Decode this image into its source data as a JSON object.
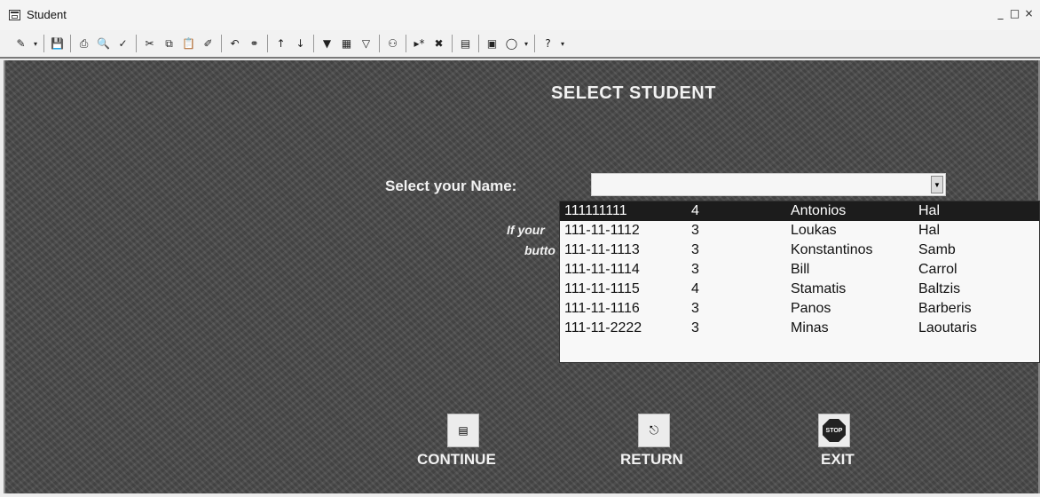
{
  "window": {
    "title": "Student",
    "controls": [
      "_",
      "□",
      "×"
    ]
  },
  "toolbar": {
    "icons": [
      "view-icon",
      "save-icon",
      "print-icon",
      "print-preview-icon",
      "spelling-icon",
      "cut-icon",
      "copy-icon",
      "paste-icon",
      "format-painter-icon",
      "undo-icon",
      "hyperlink-icon",
      "sort-ascending-icon",
      "sort-descending-icon",
      "filter-by-selection-icon",
      "filter-by-form-icon",
      "apply-filter-icon",
      "find-icon",
      "new-record-icon",
      "delete-record-icon",
      "properties-icon",
      "database-window-icon",
      "new-object-icon",
      "help-icon"
    ]
  },
  "form": {
    "title": "SELECT STUDENT",
    "select_label": "Select your Name:",
    "combo_value": "",
    "hint_line1": "If your",
    "hint_line2": "butto"
  },
  "dropdown": {
    "selected_index": 0,
    "rows": [
      {
        "id": "111111111",
        "num": "4",
        "first": "Antonios",
        "last": "Hal"
      },
      {
        "id": "111-11-1112",
        "num": "3",
        "first": "Loukas",
        "last": "Hal"
      },
      {
        "id": "111-11-1113",
        "num": "3",
        "first": "Konstantinos",
        "last": "Samb"
      },
      {
        "id": "111-11-1114",
        "num": "3",
        "first": "Bill",
        "last": "Carrol"
      },
      {
        "id": "111-11-1115",
        "num": "4",
        "first": "Stamatis",
        "last": "Baltzis"
      },
      {
        "id": "111-11-1116",
        "num": "3",
        "first": "Panos",
        "last": "Barberis"
      },
      {
        "id": "111-11-2222",
        "num": "3",
        "first": "Minas",
        "last": "Laoutaris"
      }
    ]
  },
  "buttons": {
    "continue_label": "CONTINUE",
    "return_label": "RETURN",
    "exit_label": "EXIT",
    "stop_text": "STOP"
  }
}
